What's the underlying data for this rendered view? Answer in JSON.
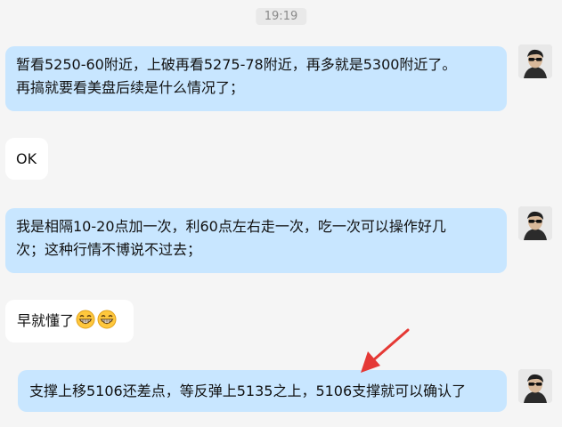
{
  "timestamp": "19:19",
  "messages": [
    {
      "side": "out",
      "text_line1": "暂看5250-60附近，上破再看5275-78附近，再多就是5300附近了。",
      "text_line2": "再搞就要看美盘后续是什么情况了；"
    },
    {
      "side": "in",
      "text": "OK"
    },
    {
      "side": "out",
      "text_line1": "我是相隔10-20点加一次，利60点左右走一次，吃一次可以操作好几",
      "text_line2": "次；这种行情不博说不过去；"
    },
    {
      "side": "in",
      "text": "早就懂了",
      "emojis": [
        "grin-emoji",
        "grin-emoji"
      ]
    },
    {
      "side": "out",
      "text": "支撑上移5106还差点，等反弹上5135之上，5106支撑就可以确认了"
    }
  ],
  "annotation": {
    "color": "#e53935",
    "icon": "arrow-annotation"
  },
  "colors": {
    "out_bubble": "#c8e6ff",
    "in_bubble": "#ffffff",
    "background": "#f5f5f5"
  }
}
